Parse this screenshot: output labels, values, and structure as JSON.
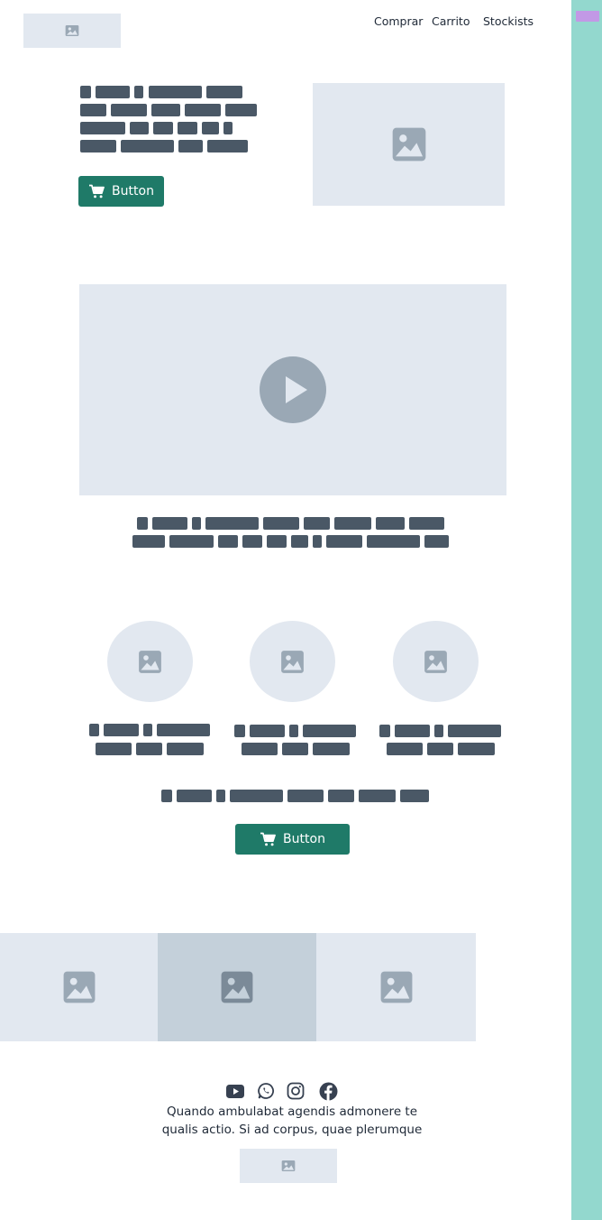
{
  "header": {
    "logo_icon": "image-icon",
    "nav": [
      "Comprar",
      "Carrito",
      "Stockists"
    ]
  },
  "hero": {
    "button_label": "Button",
    "button_icon": "cart-icon",
    "image_icon": "image-icon"
  },
  "video": {
    "play_icon": "play-icon"
  },
  "features": {
    "items": [
      {
        "icon": "image-icon"
      },
      {
        "icon": "image-icon"
      },
      {
        "icon": "image-icon"
      }
    ],
    "button_label": "Button",
    "button_icon": "cart-icon"
  },
  "gallery": {
    "tiles": [
      "image-icon",
      "image-icon",
      "image-icon"
    ]
  },
  "footer": {
    "social": [
      "youtube-icon",
      "whatsapp-icon",
      "instagram-icon",
      "facebook-icon"
    ],
    "text_line1": "Quando ambulabat agendis admonere te",
    "text_line2": "qualis actio. Si ad corpus, quae plerumque",
    "logo_icon": "image-icon"
  },
  "colors": {
    "accent": "#1f7a68",
    "placeholder": "#e2e8f0",
    "text_block": "#4a5866",
    "sidebar": "#93d8ce",
    "sidebar_chip": "#c299e6"
  }
}
